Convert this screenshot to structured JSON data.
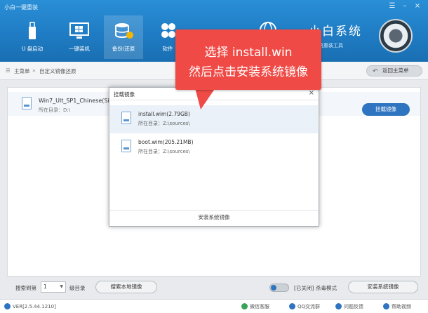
{
  "app": {
    "title": "小白一键重装"
  },
  "nav": {
    "items": [
      {
        "label": "U 盘启动",
        "icon": "usb-drive-icon"
      },
      {
        "label": "一键装机",
        "icon": "windows-monitor-icon"
      },
      {
        "label": "备份/还原",
        "icon": "backup-restore-icon"
      },
      {
        "label": "软件",
        "icon": "software-icon"
      },
      {
        "label": "",
        "icon": "globe-icon"
      }
    ],
    "active_index": 2
  },
  "brand": {
    "name": "小白系统",
    "url": "的系统重装工具"
  },
  "breadcrumb": {
    "home": "主菜单",
    "separator": "»",
    "current": "自定义镜像还原",
    "back_button": "返回主菜单"
  },
  "file": {
    "name": "Win7_Ult_SP1_Chinese(Si",
    "path": "所在目录：D:\\",
    "mount_button": "挂载镜像"
  },
  "dialog": {
    "title": "挂载镜像",
    "close": "×",
    "items": [
      {
        "name": "install.wim(2.79GB)",
        "dir": "所在目录：Z:\\sources\\"
      },
      {
        "name": "boot.wim(205.21MB)",
        "dir": "所在目录：Z:\\sources\\"
      }
    ],
    "selected_index": 0,
    "install_button": "安装系统镜像"
  },
  "callout": {
    "line1": "选择 install.win",
    "line2": "然后点击安装系统镜像"
  },
  "bottom": {
    "search_label": "搜索到第",
    "depth_value": "1",
    "depth_label": "级目录",
    "search_local_button": "搜索本地镜像",
    "toggle_state_label": "[已关闭]",
    "mode_label": "杀毒模式",
    "install_button": "安装系统镜像"
  },
  "status": {
    "version": "VER[2.5.44.1210]",
    "wechat": "微信客服",
    "qq": "QQ交流群",
    "feedback": "问题反馈",
    "help": "帮助视频"
  },
  "colors": {
    "header_blue": "#1f7cc4",
    "accent_blue": "#2f74c0",
    "callout_red": "#ef4a45",
    "selected_row": "#eaf1f9"
  }
}
